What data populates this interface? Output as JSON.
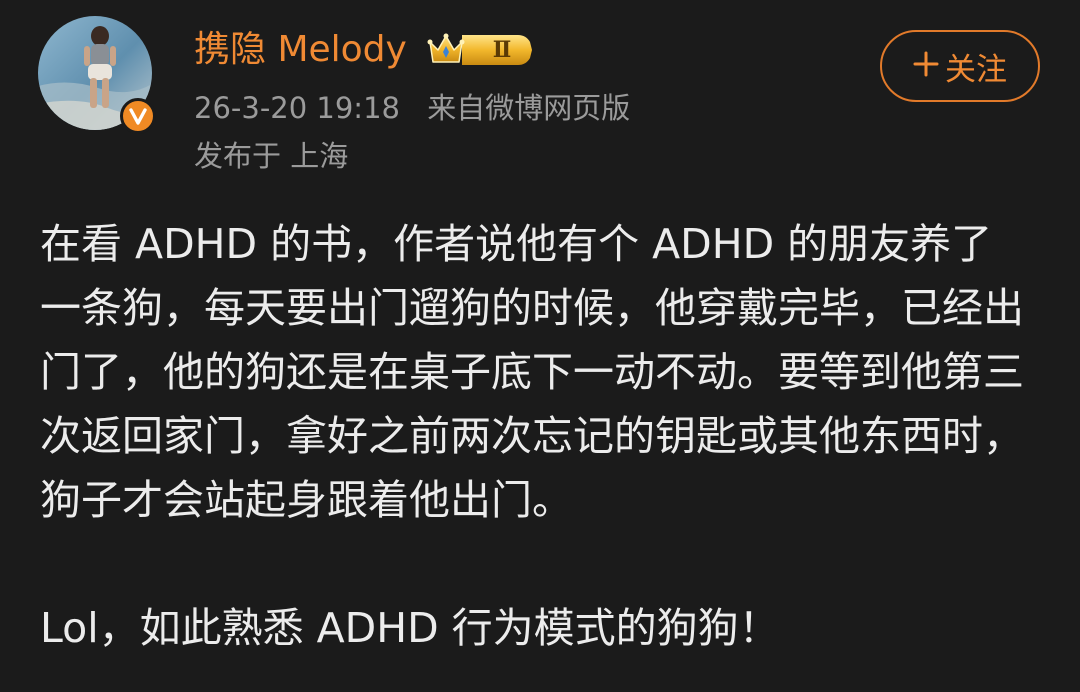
{
  "author": {
    "name": "携隐 Melody",
    "rank_label": "Ⅱ",
    "avatar_icon": "user-avatar-photo",
    "verified_icon": "verified-v-icon",
    "rank_icon": "crown-rank-badge-icon",
    "name_color": "#f08a34",
    "badge_color": "#f08a24"
  },
  "meta": {
    "timestamp": "26-3-20 19:18",
    "source": "来自微博网页版",
    "location": "发布于 上海"
  },
  "follow": {
    "icon": "plus-icon",
    "label": "关注",
    "accent_color": "#e27a2a"
  },
  "post": {
    "paragraph1": "在看 ADHD 的书，作者说他有个 ADHD 的朋友养了一条狗，每天要出门遛狗的时候，他穿戴完毕，已经出门了，他的狗还是在桌子底下一动不动。要等到他第三次返回家门，拿好之前两次忘记的钥匙或其他东西时，狗子才会站起身跟着他出门。",
    "paragraph2": "Lol，如此熟悉 ADHD 行为模式的狗狗！"
  }
}
